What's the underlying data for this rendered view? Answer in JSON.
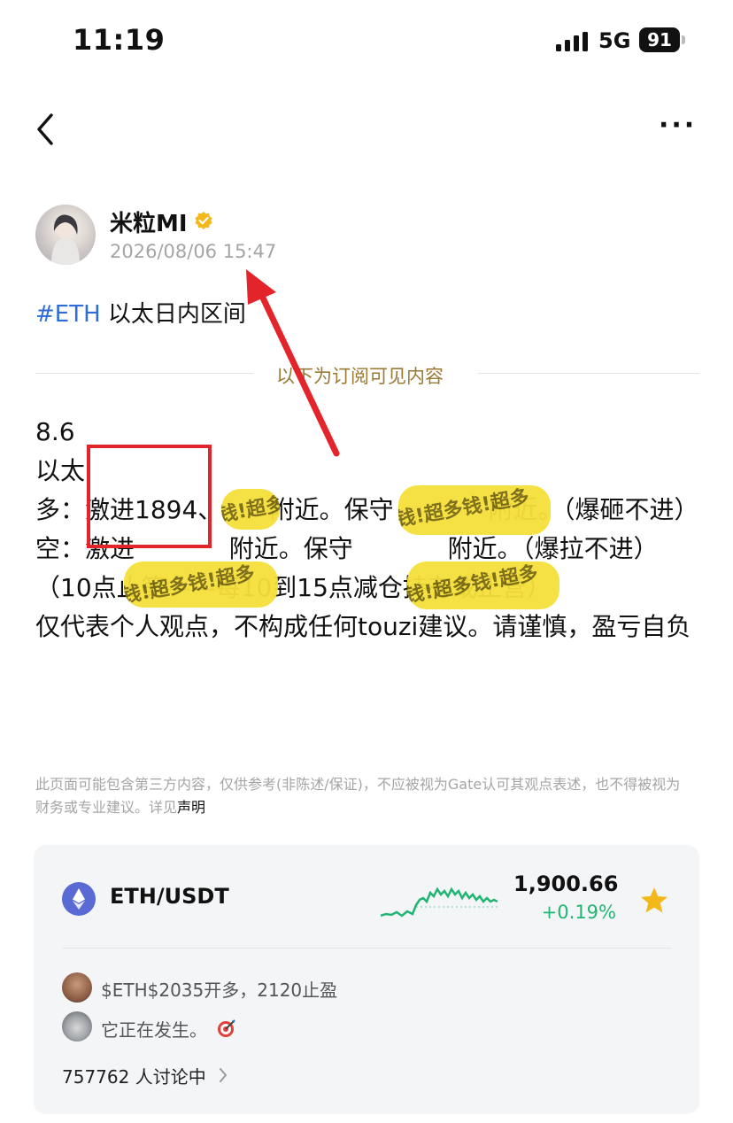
{
  "status_bar": {
    "time": "11:19",
    "network": "5G",
    "battery": "91"
  },
  "post": {
    "author": "米粒MI",
    "date": "2026/08/06 15:47",
    "hashtag": "#ETH",
    "title": "以太日内区间",
    "divider_label": "以下为订阅可见内容",
    "lines": [
      "8.6",
      "以太",
      "多：激进1894、      附近。保守            附近。（爆砸不进）",
      "空：激进            附近。保守            附近。（爆拉不进）",
      "（10点止笋——每10到15点减仓持有或止营）",
      "仅代表个人观点，不构成任何touzi建议。请谨慎，盈亏自负"
    ],
    "disclaimer": "此页面可能包含第三方内容，仅供参考(非陈述/保证)，不应被视为Gate认可其观点表述，也不得被视为财务或专业建议。详见",
    "disclaimer_link": "声明",
    "overlay_text": "钱!超多钱!超多"
  },
  "card": {
    "pair": "ETH/USDT",
    "price": "1,900.66",
    "change": "+0.19%",
    "comments": [
      {
        "text": "$ETH$2035开多，2120止盈"
      },
      {
        "text": "它正在发生。"
      }
    ],
    "discussion": "757762 人讨论中"
  },
  "colors": {
    "hashtag": "#2d6cd9",
    "divider_label": "#9a7a34",
    "up_green": "#21b573",
    "star": "#f5b81b",
    "annotation_red": "#e3242b",
    "marker_yellow": "#f6e03b"
  },
  "icons": [
    "back-icon",
    "more-icon",
    "verified-icon",
    "eth-icon",
    "star-icon",
    "target-icon",
    "chevron-right-icon"
  ]
}
